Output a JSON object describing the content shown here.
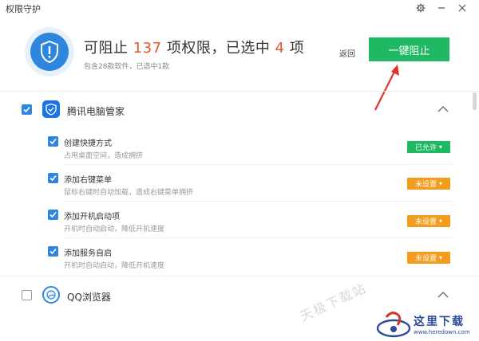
{
  "window": {
    "title": "权限守护"
  },
  "header": {
    "prefix": "可阻止 ",
    "blocked_count": "137",
    "middle": " 项权限，已选中 ",
    "selected_count": "4",
    "suffix": " 项",
    "subtitle": "包含28款软件，已选中1款",
    "back_label": "返回",
    "block_button_label": "一键阻止"
  },
  "sections": [
    {
      "name": "腾讯电脑管家",
      "checked": true,
      "icon": "tencent-pc-manager-icon",
      "items": [
        {
          "title": "创建快捷方式",
          "desc": "占用桌面空间，造成拥挤",
          "status": "已允许",
          "status_color": "#1fb863",
          "checked": true
        },
        {
          "title": "添加右键菜单",
          "desc": "鼠标右键时自动加载，造成右键菜单拥挤",
          "status": "未设置",
          "status_color": "#f39c1e",
          "checked": true
        },
        {
          "title": "添加开机启动项",
          "desc": "开机时自动启动，降低开机速度",
          "status": "未设置",
          "status_color": "#f39c1e",
          "checked": true
        },
        {
          "title": "添加服务自启",
          "desc": "开机时自动启动，降低开机速度",
          "status": "未设置",
          "status_color": "#f39c1e",
          "checked": true
        }
      ]
    },
    {
      "name": "QQ浏览器",
      "checked": false,
      "icon": "qq-browser-icon",
      "items": []
    }
  ],
  "watermark": {
    "text": "天极下载站",
    "logo_title": "这里下载",
    "logo_url": "www.heredown.com"
  },
  "colors": {
    "accent_blue": "#2e86de",
    "green": "#1fb863",
    "orange": "#f39c1e",
    "highlight": "#e4572e"
  }
}
